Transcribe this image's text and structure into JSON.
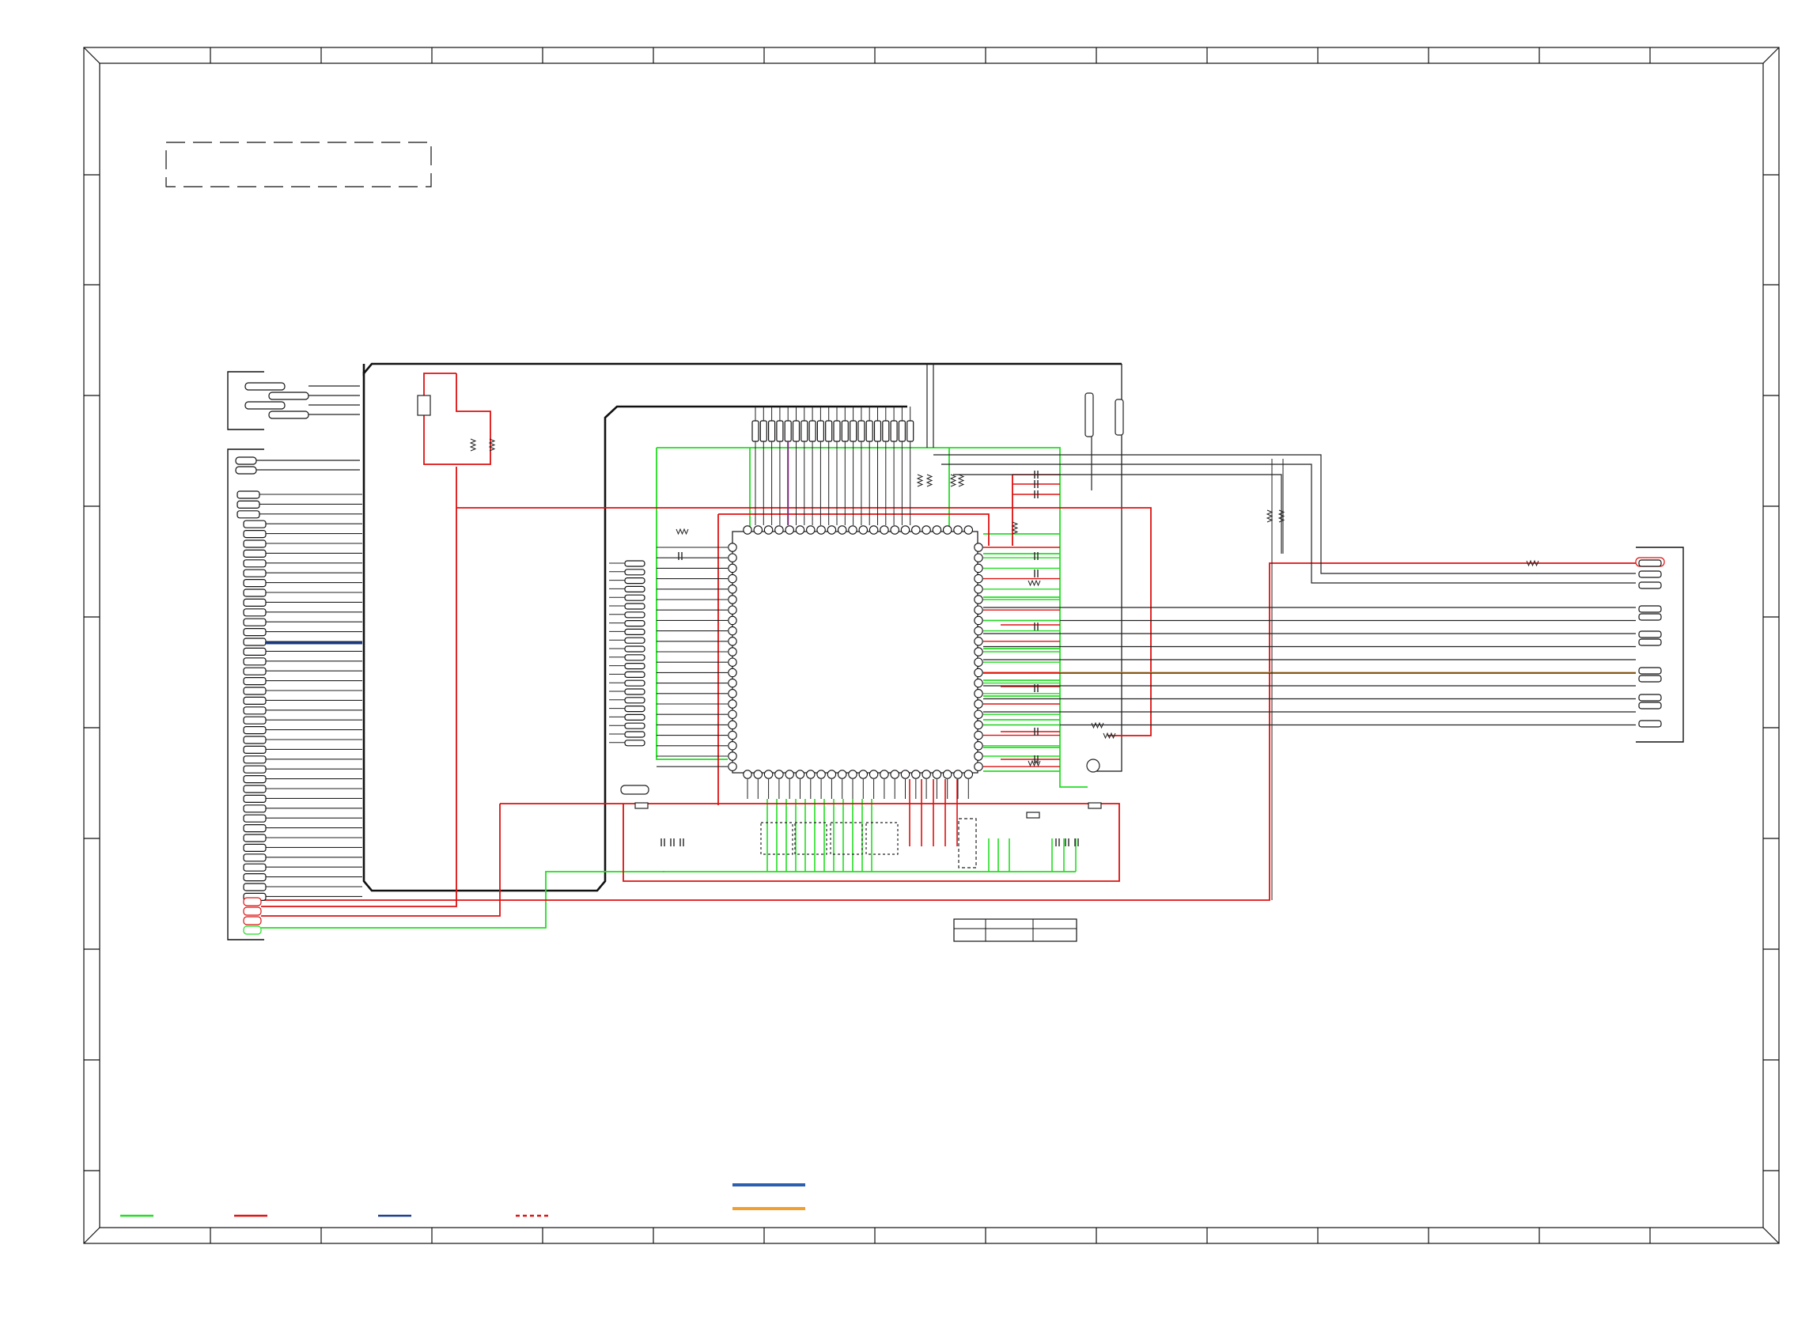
{
  "colors": {
    "frame": "#111111",
    "wire": "#222222",
    "ground": "#22dd22",
    "power": "#dd1111",
    "bus": "#1a3d8a",
    "highlight_blue": "#2b5fb0",
    "highlight_orange": "#f0a030",
    "accent_purple": "#7a2a7a",
    "background": "#ffffff"
  },
  "legend": {
    "items": [
      {
        "id": "ground",
        "color": "#22dd22",
        "style": "solid"
      },
      {
        "id": "power",
        "color": "#dd1111",
        "style": "solid"
      },
      {
        "id": "bus",
        "color": "#1a3d8a",
        "style": "solid"
      },
      {
        "id": "power-dashed",
        "color": "#dd1111",
        "style": "dashed"
      }
    ],
    "signal_samples": [
      {
        "id": "signal-blue",
        "color": "#2b5fb0"
      },
      {
        "id": "signal-orange",
        "color": "#f0a030"
      }
    ]
  },
  "components": {
    "main_ic": {
      "pins_per_side": 22,
      "kind": "qfp-ic"
    },
    "left_connector": {
      "pins": 42,
      "kind": "board-connector"
    },
    "right_connector": {
      "pins": 14,
      "kind": "output-connector"
    },
    "bottom_connector": {
      "pins": 4,
      "kind": "power-connector"
    }
  },
  "title_block": {
    "rows": 2,
    "cols": 3
  }
}
